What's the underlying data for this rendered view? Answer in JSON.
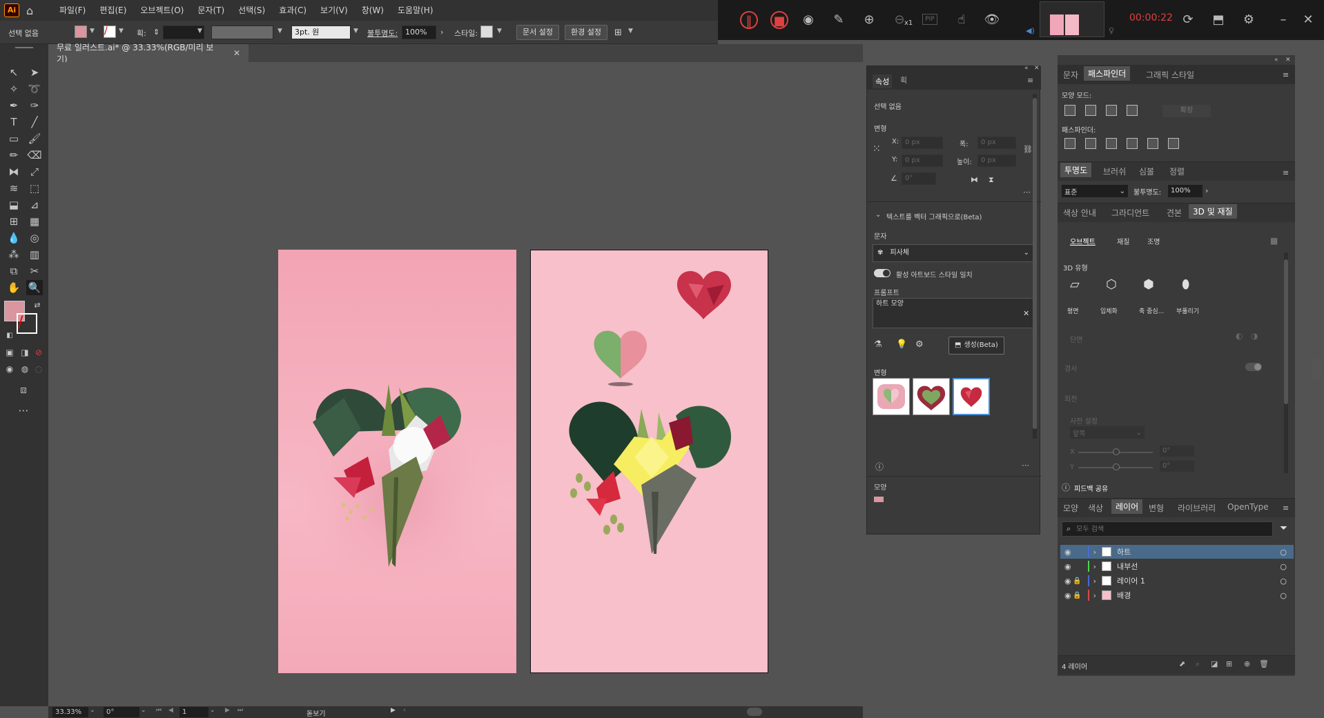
{
  "menubar": {
    "logo": "Ai",
    "items": [
      "파일(F)",
      "편집(E)",
      "오브젝트(O)",
      "문자(T)",
      "선택(S)",
      "효과(C)",
      "보기(V)",
      "창(W)",
      "도움말(H)"
    ]
  },
  "recorder": {
    "time": "00:00:22",
    "zoom_suffix": "x1",
    "pip_label": "PIP"
  },
  "controlbar": {
    "selection": "선택 없음",
    "stroke_label": "획:",
    "brush_value": "3pt. 원",
    "opacity_label": "불투명도:",
    "opacity_value": "100%",
    "style_label": "스타일:",
    "doc_setup": "문서 설정",
    "prefs": "환경 설정"
  },
  "document": {
    "tab_title": "무료 일러스트.ai* @ 33.33%(RGB/미리 보기)"
  },
  "properties": {
    "tabs": [
      "속성",
      "획"
    ],
    "selection": "선택 없음",
    "transform_label": "변형",
    "x_label": "X:",
    "y_label": "Y:",
    "w_label": "폭:",
    "h_label": "높이:",
    "x_value": "0 px",
    "y_value": "0 px",
    "w_value": "0 px",
    "h_value": "0 px",
    "angle_value": "0°",
    "t2v_title": "텍스트를 벡터 그래픽으로(Beta)",
    "type_label": "문자",
    "type_value": "피사체",
    "toggle_label": "활성 아트보드 스타일 일치",
    "prompt_label": "프롬프트",
    "prompt_value": "하트 모양",
    "generate_btn": "생성(Beta)",
    "variations_label": "변형",
    "appearance_label": "모양"
  },
  "rpanel": {
    "top_tabs": [
      "문자",
      "패스파인더",
      "그래픽 스타일"
    ],
    "shape_mode_label": "모양 모드:",
    "expand_btn": "확장",
    "pathfinder_label": "패스파인더:",
    "mid_tabs": [
      "투명도",
      "브러쉬",
      "심볼",
      "정렬"
    ],
    "blend_mode": "표준",
    "opacity_label": "불투명도:",
    "opacity_value": "100%",
    "lower_tabs": [
      "색상 안내",
      "그라디언트",
      "견본",
      "3D 및 재질"
    ],
    "sub_tabs": [
      "오브젝트",
      "재질",
      "조명"
    ],
    "type3d_label": "3D 유형",
    "type3d": [
      "평면",
      "입체화",
      "축 중심...",
      "부풀리기"
    ],
    "bevel_label": "단면",
    "bevel2_label": "경사",
    "rotate_label": "회전",
    "preset_label": "사전 설정",
    "preset_value": "앞쪽",
    "rot_x": "X",
    "rot_y": "Y",
    "rot_x_val": "0°",
    "rot_y_val": "0°",
    "feedback": "피드백 공유",
    "layer_tabs": [
      "모양",
      "색상",
      "레이어",
      "변형",
      "라이브러리",
      "OpenType"
    ],
    "search_placeholder": "모두 검색",
    "layers": [
      "하트",
      "내부선",
      "레이어 1",
      "배경"
    ],
    "layer_count": "4 레이어"
  },
  "status": {
    "zoom": "33.33%",
    "angle": "0°",
    "page": "1",
    "mode": "돋보기"
  },
  "colors": {
    "fill_swatch": "#d9969f",
    "accent": "#e04040"
  }
}
